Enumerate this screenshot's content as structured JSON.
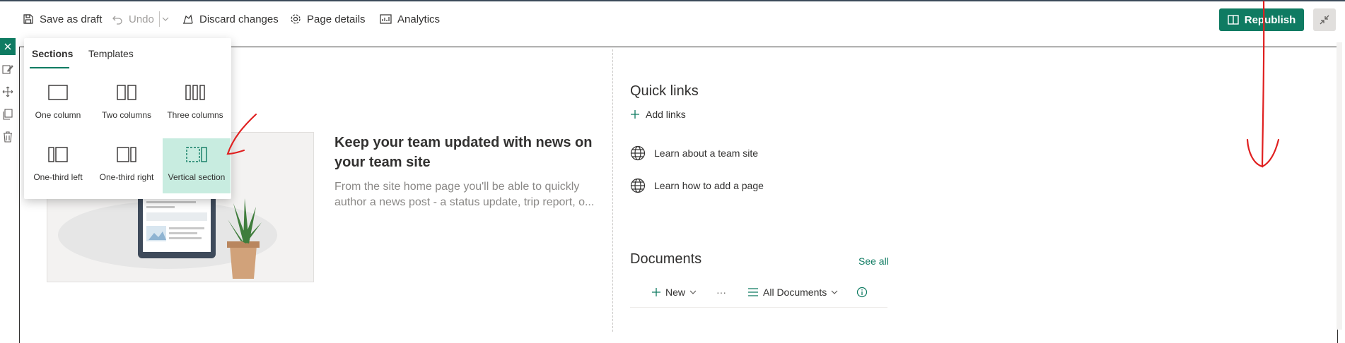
{
  "toolbar": {
    "save_draft": "Save as draft",
    "undo": "Undo",
    "discard": "Discard changes",
    "page_details": "Page details",
    "analytics": "Analytics",
    "republish": "Republish"
  },
  "sections_panel": {
    "tabs": [
      "Sections",
      "Templates"
    ],
    "active_tab": "Sections",
    "layouts": [
      {
        "label": "One column",
        "icon": "one-column-icon"
      },
      {
        "label": "Two columns",
        "icon": "two-columns-icon"
      },
      {
        "label": "Three columns",
        "icon": "three-columns-icon"
      },
      {
        "label": "One-third left",
        "icon": "one-third-left-icon"
      },
      {
        "label": "One-third right",
        "icon": "one-third-right-icon"
      },
      {
        "label": "Vertical section",
        "icon": "vertical-section-icon",
        "selected": true
      }
    ]
  },
  "news": {
    "title": "Keep your team updated with news on your team site",
    "description": "From the site home page you'll be able to quickly author a news post - a status update, trip report, o..."
  },
  "quick_links": {
    "title": "Quick links",
    "add": "Add links",
    "links": [
      "Learn about a team site",
      "Learn how to add a page"
    ]
  },
  "documents": {
    "title": "Documents",
    "see_all": "See all",
    "new": "New",
    "more": "···",
    "view": "All Documents"
  },
  "colors": {
    "accent": "#0f7b62",
    "selected_tile": "#c8ece0",
    "annotation": "#e02020"
  }
}
